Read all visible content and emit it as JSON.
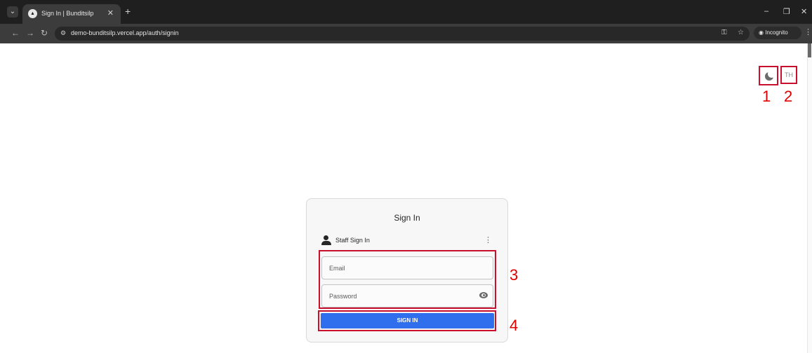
{
  "browser": {
    "tab_title": "Sign In | Bunditsilp",
    "url": "demo-bunditsilp.vercel.app/auth/signin",
    "incognito_label": "Incognito"
  },
  "page": {
    "lang_toggle": "TH"
  },
  "card": {
    "title": "Sign In",
    "section_label": "Staff Sign In",
    "email_label": "Email",
    "password_label": "Password",
    "submit_label": "SIGN IN"
  },
  "annotations": [
    "1",
    "2",
    "3",
    "4"
  ],
  "colors": {
    "accent": "#2f6fed",
    "annotation": "#c8102e",
    "chrome_dark": "#1f1f1f"
  }
}
